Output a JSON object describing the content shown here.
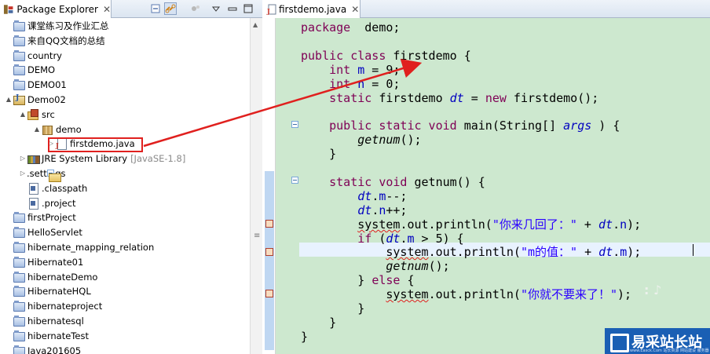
{
  "package_explorer": {
    "tab_label": "Package Explorer",
    "close_glyph": "✕",
    "tree": [
      {
        "label": "课堂练习及作业汇总",
        "type": "proj",
        "depth": 0,
        "twisty": ""
      },
      {
        "label": "来自QQ文档的总结",
        "type": "proj",
        "depth": 0,
        "twisty": ""
      },
      {
        "label": "country",
        "type": "proj",
        "depth": 0,
        "twisty": ""
      },
      {
        "label": "DEMO",
        "type": "proj",
        "depth": 0,
        "twisty": ""
      },
      {
        "label": "DEMO01",
        "type": "proj",
        "depth": 0,
        "twisty": ""
      },
      {
        "label": "Demo02",
        "type": "jproj",
        "depth": 0,
        "twisty": "▲"
      },
      {
        "label": "src",
        "type": "srcf",
        "depth": 1,
        "twisty": "▲"
      },
      {
        "label": "demo",
        "type": "pkg",
        "depth": 2,
        "twisty": "▲"
      },
      {
        "label": "firstdemo.java",
        "type": "jfile",
        "depth": 3,
        "twisty": "▷"
      },
      {
        "label": "JRE System Library",
        "decor": "[JavaSE-1.8]",
        "type": "lib",
        "depth": 1,
        "twisty": "▷"
      },
      {
        "label": ".settings",
        "type": "fold",
        "depth": 1,
        "twisty": "▷"
      },
      {
        "label": ".classpath",
        "type": "doc",
        "depth": 1,
        "twisty": ""
      },
      {
        "label": ".project",
        "type": "doc",
        "depth": 1,
        "twisty": ""
      },
      {
        "label": "firstProject",
        "type": "proj",
        "depth": 0,
        "twisty": ""
      },
      {
        "label": "HelloServlet",
        "type": "proj",
        "depth": 0,
        "twisty": ""
      },
      {
        "label": "hibernate_mapping_relation",
        "type": "proj",
        "depth": 0,
        "twisty": ""
      },
      {
        "label": "Hibernate01",
        "type": "proj",
        "depth": 0,
        "twisty": ""
      },
      {
        "label": "hibernateDemo",
        "type": "proj",
        "depth": 0,
        "twisty": ""
      },
      {
        "label": "HibernateHQL",
        "type": "proj",
        "depth": 0,
        "twisty": ""
      },
      {
        "label": "hibernateproject",
        "type": "proj",
        "depth": 0,
        "twisty": ""
      },
      {
        "label": "hibernatesql",
        "type": "proj",
        "depth": 0,
        "twisty": ""
      },
      {
        "label": "hibernateTest",
        "type": "proj",
        "depth": 0,
        "twisty": ""
      },
      {
        "label": "Java201605",
        "type": "proj",
        "depth": 0,
        "twisty": ""
      }
    ]
  },
  "editor": {
    "tab_label": "firstdemo.java",
    "close_glyph": "✕",
    "code_lines": [
      [
        [
          "kw",
          "package"
        ],
        [
          "",
          "  demo;"
        ]
      ],
      [],
      [
        [
          "kw",
          "public class"
        ],
        [
          "",
          " firstdemo {"
        ]
      ],
      [
        [
          "",
          ""
        ],
        [
          "kw",
          "    int "
        ],
        [
          "fld2",
          "m"
        ],
        [
          "",
          " = 9;"
        ]
      ],
      [
        [
          "kw",
          "    int "
        ],
        [
          "fld2",
          "n"
        ],
        [
          "",
          " = 0;"
        ]
      ],
      [
        [
          "kw",
          "    static"
        ],
        [
          "",
          " firstdemo "
        ],
        [
          "fld",
          "dt"
        ],
        [
          "",
          " = "
        ],
        [
          "kw",
          "new"
        ],
        [
          "",
          " firstdemo();"
        ]
      ],
      [],
      [
        [
          "kw",
          "    public static void"
        ],
        [
          "",
          " main(String[] "
        ],
        [
          "fld",
          "args"
        ],
        [
          "",
          " ) {"
        ]
      ],
      [
        [
          "",
          "        "
        ],
        [
          "meth",
          "getnum"
        ],
        [
          "",
          "();"
        ]
      ],
      [
        [
          "",
          "    }"
        ]
      ],
      [],
      [
        [
          "kw",
          "    static void"
        ],
        [
          "",
          " getnum() {"
        ]
      ],
      [
        [
          "",
          "        "
        ],
        [
          "fld",
          "dt"
        ],
        [
          "",
          "."
        ],
        [
          "fld2",
          "m"
        ],
        [
          "",
          "--;"
        ]
      ],
      [
        [
          "",
          "        "
        ],
        [
          "fld",
          "dt"
        ],
        [
          "",
          "."
        ],
        [
          "fld2",
          "n"
        ],
        [
          "",
          "++;"
        ]
      ],
      [
        [
          "",
          "        "
        ],
        [
          "warn",
          "system"
        ],
        [
          "",
          ".out.println("
        ],
        [
          "str",
          "\"你来几回了：\""
        ],
        [
          "",
          " + "
        ],
        [
          "fld",
          "dt"
        ],
        [
          "",
          "."
        ],
        [
          "fld2",
          "n"
        ],
        [
          "",
          ");"
        ]
      ],
      [
        [
          "",
          "        "
        ],
        [
          "kw",
          "if"
        ],
        [
          "",
          " ("
        ],
        [
          "fld",
          "dt"
        ],
        [
          "",
          "."
        ],
        [
          "fld2",
          "m"
        ],
        [
          "",
          " > 5) {"
        ]
      ],
      [
        [
          "",
          "            "
        ],
        [
          "warn",
          "system"
        ],
        [
          "",
          ".out.println("
        ],
        [
          "str",
          "\"m的值：\""
        ],
        [
          "",
          " + "
        ],
        [
          "fld",
          "dt"
        ],
        [
          "",
          "."
        ],
        [
          "fld2",
          "m"
        ],
        [
          "",
          ");"
        ]
      ],
      [
        [
          "",
          "            "
        ],
        [
          "meth",
          "getnum"
        ],
        [
          "",
          "();"
        ]
      ],
      [
        [
          "",
          "        } "
        ],
        [
          "kw",
          "else"
        ],
        [
          "",
          " {"
        ]
      ],
      [
        [
          "",
          "            "
        ],
        [
          "warn",
          "system"
        ],
        [
          "",
          ".out.println("
        ],
        [
          "str",
          "\"你就不要来了！\""
        ],
        [
          "",
          ");"
        ]
      ],
      [
        [
          "",
          "        }"
        ]
      ],
      [
        [
          "",
          "    }"
        ]
      ],
      [
        [
          "",
          "}"
        ]
      ]
    ]
  },
  "watermark": {
    "text": "易采站长站",
    "sub": "www.Easck.Com 站长资源 网站建设 服务器"
  },
  "colors": {
    "editor_bg": "#cde8cf",
    "keyword": "#7f0055",
    "field": "#0000c0",
    "string": "#2a00ff",
    "annotation_red": "#e0201e"
  }
}
